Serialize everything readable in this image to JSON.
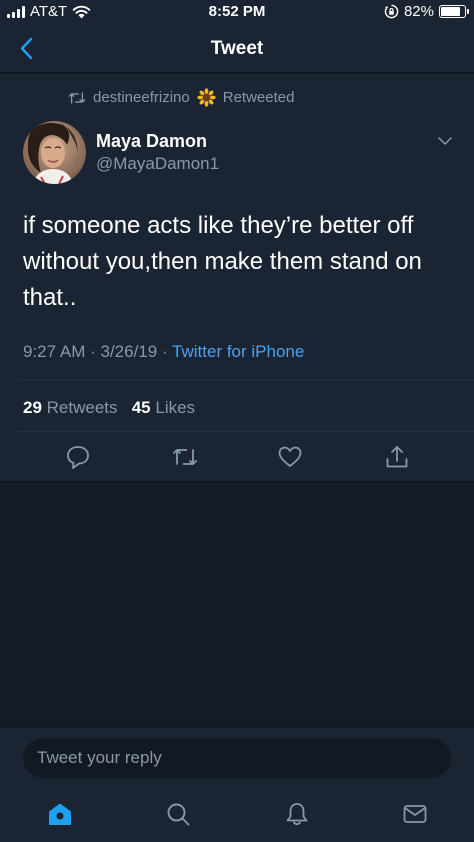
{
  "status_bar": {
    "carrier": "AT&T",
    "time": "8:52 PM",
    "battery_percent": "82%",
    "battery_level": 0.82
  },
  "nav": {
    "title": "Tweet",
    "back_icon": "chevron-left-icon"
  },
  "tweet": {
    "retweeted_by": "destineefrizino",
    "retweeted_by_emoji": "sunflower-icon",
    "retweeted_label": "Retweeted",
    "author_name": "Maya Damon",
    "author_handle": "@MayaDamon1",
    "text": "if someone acts like they’re better off without you,then make them stand on that..",
    "time": "9:27 AM",
    "date": "3/26/19",
    "source": "Twitter for iPhone",
    "retweet_count": "29",
    "retweet_label": "Retweets",
    "like_count": "45",
    "like_label": "Likes"
  },
  "actions": [
    "reply-icon",
    "retweet-icon",
    "like-icon",
    "share-icon"
  ],
  "reply": {
    "placeholder": "Tweet your reply"
  },
  "tabs": [
    "home-icon",
    "search-icon",
    "notifications-icon",
    "messages-icon"
  ],
  "colors": {
    "background": "#141b26",
    "panel": "#1b2432",
    "accent": "#1da1f2",
    "muted": "#8899a6",
    "link": "#4aa1f0"
  }
}
